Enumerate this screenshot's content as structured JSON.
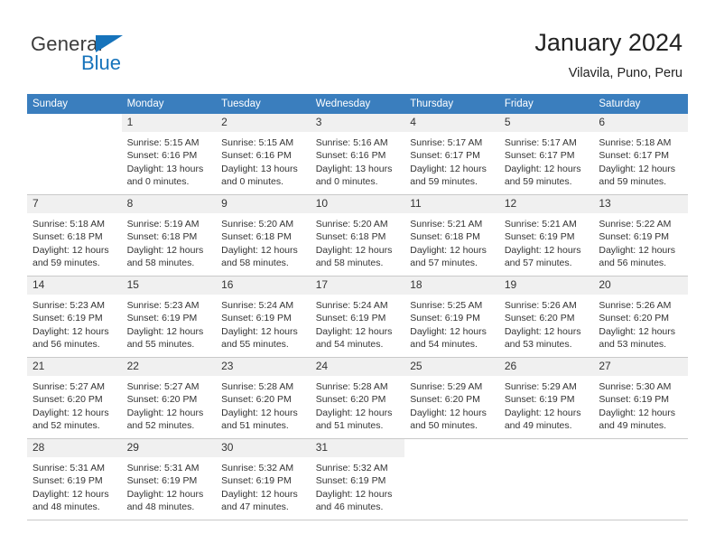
{
  "brand": {
    "name_dark": "General",
    "name_blue": "Blue",
    "accent_color": "#1673bb"
  },
  "header": {
    "title": "January 2024",
    "subtitle": "Vilavila, Puno, Peru",
    "header_bg": "#3a7ebe",
    "daynum_bg": "#f0f0f0"
  },
  "weekday_headers": [
    "Sunday",
    "Monday",
    "Tuesday",
    "Wednesday",
    "Thursday",
    "Friday",
    "Saturday"
  ],
  "labels": {
    "sunrise_prefix": "Sunrise:",
    "sunset_prefix": "Sunset:",
    "daylight_prefix": "Daylight:"
  },
  "weeks": [
    [
      {
        "day": "",
        "blank": true,
        "sunrise": "",
        "sunset": "",
        "daylight": ""
      },
      {
        "day": "1",
        "sunrise": "Sunrise: 5:15 AM",
        "sunset": "Sunset: 6:16 PM",
        "daylight": "Daylight: 13 hours and 0 minutes."
      },
      {
        "day": "2",
        "sunrise": "Sunrise: 5:15 AM",
        "sunset": "Sunset: 6:16 PM",
        "daylight": "Daylight: 13 hours and 0 minutes."
      },
      {
        "day": "3",
        "sunrise": "Sunrise: 5:16 AM",
        "sunset": "Sunset: 6:16 PM",
        "daylight": "Daylight: 13 hours and 0 minutes."
      },
      {
        "day": "4",
        "sunrise": "Sunrise: 5:17 AM",
        "sunset": "Sunset: 6:17 PM",
        "daylight": "Daylight: 12 hours and 59 minutes."
      },
      {
        "day": "5",
        "sunrise": "Sunrise: 5:17 AM",
        "sunset": "Sunset: 6:17 PM",
        "daylight": "Daylight: 12 hours and 59 minutes."
      },
      {
        "day": "6",
        "sunrise": "Sunrise: 5:18 AM",
        "sunset": "Sunset: 6:17 PM",
        "daylight": "Daylight: 12 hours and 59 minutes."
      }
    ],
    [
      {
        "day": "7",
        "sunrise": "Sunrise: 5:18 AM",
        "sunset": "Sunset: 6:18 PM",
        "daylight": "Daylight: 12 hours and 59 minutes."
      },
      {
        "day": "8",
        "sunrise": "Sunrise: 5:19 AM",
        "sunset": "Sunset: 6:18 PM",
        "daylight": "Daylight: 12 hours and 58 minutes."
      },
      {
        "day": "9",
        "sunrise": "Sunrise: 5:20 AM",
        "sunset": "Sunset: 6:18 PM",
        "daylight": "Daylight: 12 hours and 58 minutes."
      },
      {
        "day": "10",
        "sunrise": "Sunrise: 5:20 AM",
        "sunset": "Sunset: 6:18 PM",
        "daylight": "Daylight: 12 hours and 58 minutes."
      },
      {
        "day": "11",
        "sunrise": "Sunrise: 5:21 AM",
        "sunset": "Sunset: 6:18 PM",
        "daylight": "Daylight: 12 hours and 57 minutes."
      },
      {
        "day": "12",
        "sunrise": "Sunrise: 5:21 AM",
        "sunset": "Sunset: 6:19 PM",
        "daylight": "Daylight: 12 hours and 57 minutes."
      },
      {
        "day": "13",
        "sunrise": "Sunrise: 5:22 AM",
        "sunset": "Sunset: 6:19 PM",
        "daylight": "Daylight: 12 hours and 56 minutes."
      }
    ],
    [
      {
        "day": "14",
        "sunrise": "Sunrise: 5:23 AM",
        "sunset": "Sunset: 6:19 PM",
        "daylight": "Daylight: 12 hours and 56 minutes."
      },
      {
        "day": "15",
        "sunrise": "Sunrise: 5:23 AM",
        "sunset": "Sunset: 6:19 PM",
        "daylight": "Daylight: 12 hours and 55 minutes."
      },
      {
        "day": "16",
        "sunrise": "Sunrise: 5:24 AM",
        "sunset": "Sunset: 6:19 PM",
        "daylight": "Daylight: 12 hours and 55 minutes."
      },
      {
        "day": "17",
        "sunrise": "Sunrise: 5:24 AM",
        "sunset": "Sunset: 6:19 PM",
        "daylight": "Daylight: 12 hours and 54 minutes."
      },
      {
        "day": "18",
        "sunrise": "Sunrise: 5:25 AM",
        "sunset": "Sunset: 6:19 PM",
        "daylight": "Daylight: 12 hours and 54 minutes."
      },
      {
        "day": "19",
        "sunrise": "Sunrise: 5:26 AM",
        "sunset": "Sunset: 6:20 PM",
        "daylight": "Daylight: 12 hours and 53 minutes."
      },
      {
        "day": "20",
        "sunrise": "Sunrise: 5:26 AM",
        "sunset": "Sunset: 6:20 PM",
        "daylight": "Daylight: 12 hours and 53 minutes."
      }
    ],
    [
      {
        "day": "21",
        "sunrise": "Sunrise: 5:27 AM",
        "sunset": "Sunset: 6:20 PM",
        "daylight": "Daylight: 12 hours and 52 minutes."
      },
      {
        "day": "22",
        "sunrise": "Sunrise: 5:27 AM",
        "sunset": "Sunset: 6:20 PM",
        "daylight": "Daylight: 12 hours and 52 minutes."
      },
      {
        "day": "23",
        "sunrise": "Sunrise: 5:28 AM",
        "sunset": "Sunset: 6:20 PM",
        "daylight": "Daylight: 12 hours and 51 minutes."
      },
      {
        "day": "24",
        "sunrise": "Sunrise: 5:28 AM",
        "sunset": "Sunset: 6:20 PM",
        "daylight": "Daylight: 12 hours and 51 minutes."
      },
      {
        "day": "25",
        "sunrise": "Sunrise: 5:29 AM",
        "sunset": "Sunset: 6:20 PM",
        "daylight": "Daylight: 12 hours and 50 minutes."
      },
      {
        "day": "26",
        "sunrise": "Sunrise: 5:29 AM",
        "sunset": "Sunset: 6:19 PM",
        "daylight": "Daylight: 12 hours and 49 minutes."
      },
      {
        "day": "27",
        "sunrise": "Sunrise: 5:30 AM",
        "sunset": "Sunset: 6:19 PM",
        "daylight": "Daylight: 12 hours and 49 minutes."
      }
    ],
    [
      {
        "day": "28",
        "sunrise": "Sunrise: 5:31 AM",
        "sunset": "Sunset: 6:19 PM",
        "daylight": "Daylight: 12 hours and 48 minutes."
      },
      {
        "day": "29",
        "sunrise": "Sunrise: 5:31 AM",
        "sunset": "Sunset: 6:19 PM",
        "daylight": "Daylight: 12 hours and 48 minutes."
      },
      {
        "day": "30",
        "sunrise": "Sunrise: 5:32 AM",
        "sunset": "Sunset: 6:19 PM",
        "daylight": "Daylight: 12 hours and 47 minutes."
      },
      {
        "day": "31",
        "sunrise": "Sunrise: 5:32 AM",
        "sunset": "Sunset: 6:19 PM",
        "daylight": "Daylight: 12 hours and 46 minutes."
      },
      {
        "day": "",
        "blank": true,
        "sunrise": "",
        "sunset": "",
        "daylight": ""
      },
      {
        "day": "",
        "blank": true,
        "sunrise": "",
        "sunset": "",
        "daylight": ""
      },
      {
        "day": "",
        "blank": true,
        "sunrise": "",
        "sunset": "",
        "daylight": ""
      }
    ]
  ]
}
